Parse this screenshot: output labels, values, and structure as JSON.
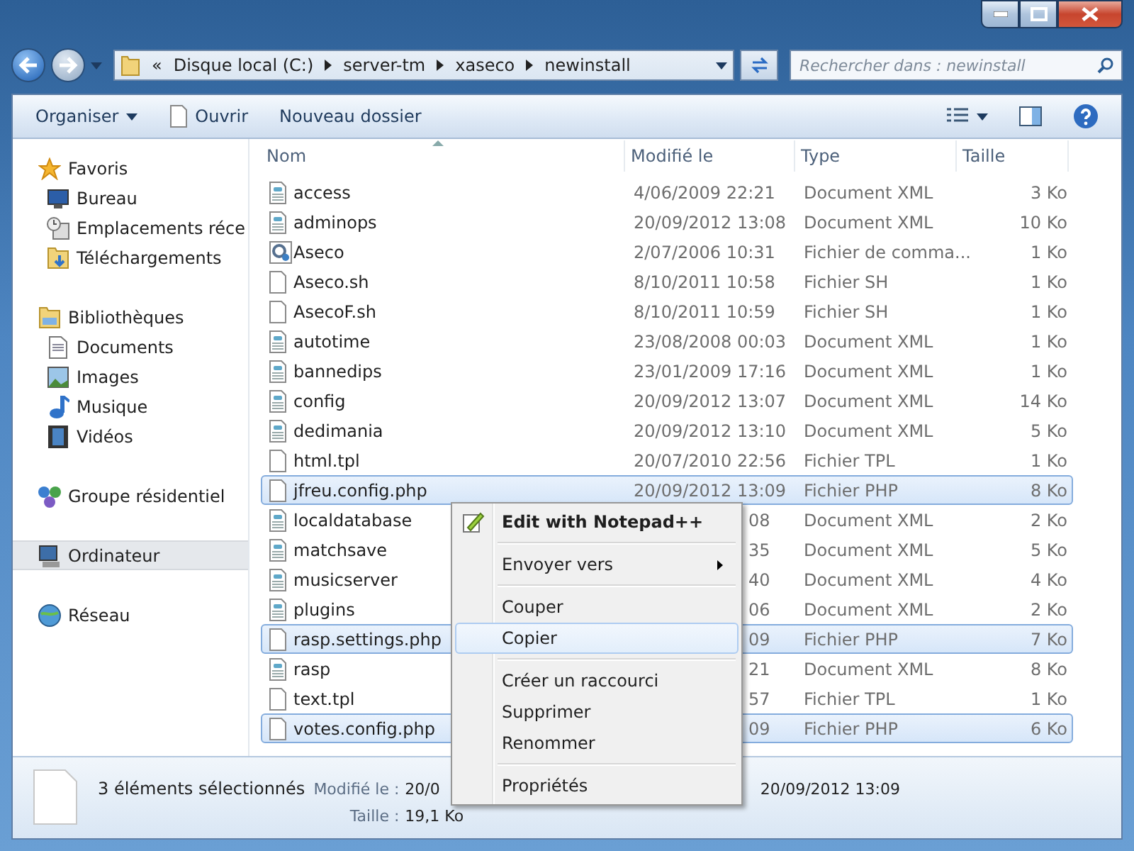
{
  "window": {
    "controls": [
      {
        "kind": "minimize"
      },
      {
        "kind": "maximize"
      },
      {
        "kind": "close"
      }
    ]
  },
  "address": {
    "overflow": "«",
    "segments": [
      "Disque local (C:)",
      "server-tm",
      "xaseco",
      "newinstall"
    ]
  },
  "search": {
    "placeholder": "Rechercher dans : newinstall"
  },
  "toolbar": {
    "buttons": [
      {
        "label": "Organiser",
        "kind": "dropdown"
      },
      {
        "label": "Ouvrir",
        "kind": "open"
      },
      {
        "label": "Nouveau dossier",
        "kind": "plain"
      }
    ]
  },
  "sidebar": {
    "groups": [
      {
        "label": "Favoris",
        "kind": "star",
        "selected": false,
        "children": [
          {
            "label": "Bureau",
            "kind": "desktop",
            "selected": false
          },
          {
            "label": "Emplacements réce",
            "kind": "recent",
            "selected": false
          },
          {
            "label": "Téléchargements",
            "kind": "download",
            "selected": false
          }
        ]
      },
      {
        "label": "Bibliothèques",
        "kind": "library",
        "selected": false,
        "children": [
          {
            "label": "Documents",
            "kind": "document",
            "selected": false
          },
          {
            "label": "Images",
            "kind": "image",
            "selected": false
          },
          {
            "label": "Musique",
            "kind": "music",
            "selected": false
          },
          {
            "label": "Vidéos",
            "kind": "video",
            "selected": false
          }
        ]
      },
      {
        "label": "Groupe résidentiel",
        "kind": "homegroup",
        "selected": false
      },
      {
        "label": "Ordinateur",
        "kind": "computer",
        "selected": true
      },
      {
        "label": "Réseau",
        "kind": "network",
        "selected": false
      }
    ]
  },
  "table": {
    "columns": [
      "Nom",
      "Modifié le",
      "Type",
      "Taille"
    ],
    "rows": [
      {
        "name": "access",
        "modified": "4/06/2009 22:21",
        "type": "Document XML",
        "size": "3 Ko",
        "kind": "xml",
        "selected": false,
        "partial": false
      },
      {
        "name": "adminops",
        "modified": "20/09/2012 13:08",
        "type": "Document XML",
        "size": "10 Ko",
        "kind": "xml",
        "selected": false,
        "partial": false
      },
      {
        "name": "Aseco",
        "modified": "2/07/2006 10:31",
        "type": "Fichier de comma...",
        "size": "1 Ko",
        "kind": "cmd",
        "selected": false,
        "partial": false
      },
      {
        "name": "Aseco.sh",
        "modified": "8/10/2011 10:58",
        "type": "Fichier SH",
        "size": "1 Ko",
        "kind": "blank",
        "selected": false,
        "partial": false
      },
      {
        "name": "AsecoF.sh",
        "modified": "8/10/2011 10:59",
        "type": "Fichier SH",
        "size": "1 Ko",
        "kind": "blank",
        "selected": false,
        "partial": false
      },
      {
        "name": "autotime",
        "modified": "23/08/2008 00:03",
        "type": "Document XML",
        "size": "1 Ko",
        "kind": "xml",
        "selected": false,
        "partial": false
      },
      {
        "name": "bannedips",
        "modified": "23/01/2009 17:16",
        "type": "Document XML",
        "size": "1 Ko",
        "kind": "xml",
        "selected": false,
        "partial": false
      },
      {
        "name": "config",
        "modified": "20/09/2012 13:07",
        "type": "Document XML",
        "size": "14 Ko",
        "kind": "xml",
        "selected": false,
        "partial": false
      },
      {
        "name": "dedimania",
        "modified": "20/09/2012 13:10",
        "type": "Document XML",
        "size": "5 Ko",
        "kind": "xml",
        "selected": false,
        "partial": false
      },
      {
        "name": "html.tpl",
        "modified": "20/07/2010 22:56",
        "type": "Fichier TPL",
        "size": "1 Ko",
        "kind": "blank",
        "selected": false,
        "partial": false
      },
      {
        "name": "jfreu.config.php",
        "modified": "20/09/2012 13:09",
        "type": "Fichier PHP",
        "size": "8 Ko",
        "kind": "blank",
        "selected": true,
        "partial": false
      },
      {
        "name": "localdatabase",
        "modified": "08",
        "type": "Document XML",
        "size": "2 Ko",
        "kind": "xml",
        "selected": false,
        "partial": true
      },
      {
        "name": "matchsave",
        "modified": "35",
        "type": "Document XML",
        "size": "5 Ko",
        "kind": "xml",
        "selected": false,
        "partial": true
      },
      {
        "name": "musicserver",
        "modified": "40",
        "type": "Document XML",
        "size": "4 Ko",
        "kind": "xml",
        "selected": false,
        "partial": true
      },
      {
        "name": "plugins",
        "modified": "06",
        "type": "Document XML",
        "size": "2 Ko",
        "kind": "xml",
        "selected": false,
        "partial": true
      },
      {
        "name": "rasp.settings.php",
        "modified": "09",
        "type": "Fichier PHP",
        "size": "7 Ko",
        "kind": "blank",
        "selected": true,
        "partial": true
      },
      {
        "name": "rasp",
        "modified": "21",
        "type": "Document XML",
        "size": "8 Ko",
        "kind": "xml",
        "selected": false,
        "partial": true
      },
      {
        "name": "text.tpl",
        "modified": "57",
        "type": "Fichier TPL",
        "size": "1 Ko",
        "kind": "blank",
        "selected": false,
        "partial": true
      },
      {
        "name": "votes.config.php",
        "modified": "09",
        "type": "Fichier PHP",
        "size": "6 Ko",
        "kind": "blank",
        "selected": true,
        "partial": true
      }
    ]
  },
  "context_menu": {
    "items": [
      {
        "kind": "default",
        "label": "Edit with Notepad++",
        "selected": false
      },
      {
        "kind": "separator"
      },
      {
        "kind": "submenu",
        "label": "Envoyer vers",
        "selected": false
      },
      {
        "kind": "separator"
      },
      {
        "kind": "item",
        "label": "Couper",
        "selected": false
      },
      {
        "kind": "item",
        "label": "Copier",
        "selected": true
      },
      {
        "kind": "separator"
      },
      {
        "kind": "item",
        "label": "Créer un raccourci",
        "selected": false
      },
      {
        "kind": "item",
        "label": "Supprimer",
        "selected": false
      },
      {
        "kind": "item",
        "label": "Renommer",
        "selected": false
      },
      {
        "kind": "separator"
      },
      {
        "kind": "item",
        "label": "Propriétés",
        "selected": false
      }
    ]
  },
  "status": {
    "count": "3 éléments sélectionnés",
    "modified_label": "Modifié le :",
    "modified_cut": "20/0",
    "modified_value": "20/09/2012 13:09",
    "size_label": "Taille :",
    "size_value": "19,1 Ko"
  }
}
